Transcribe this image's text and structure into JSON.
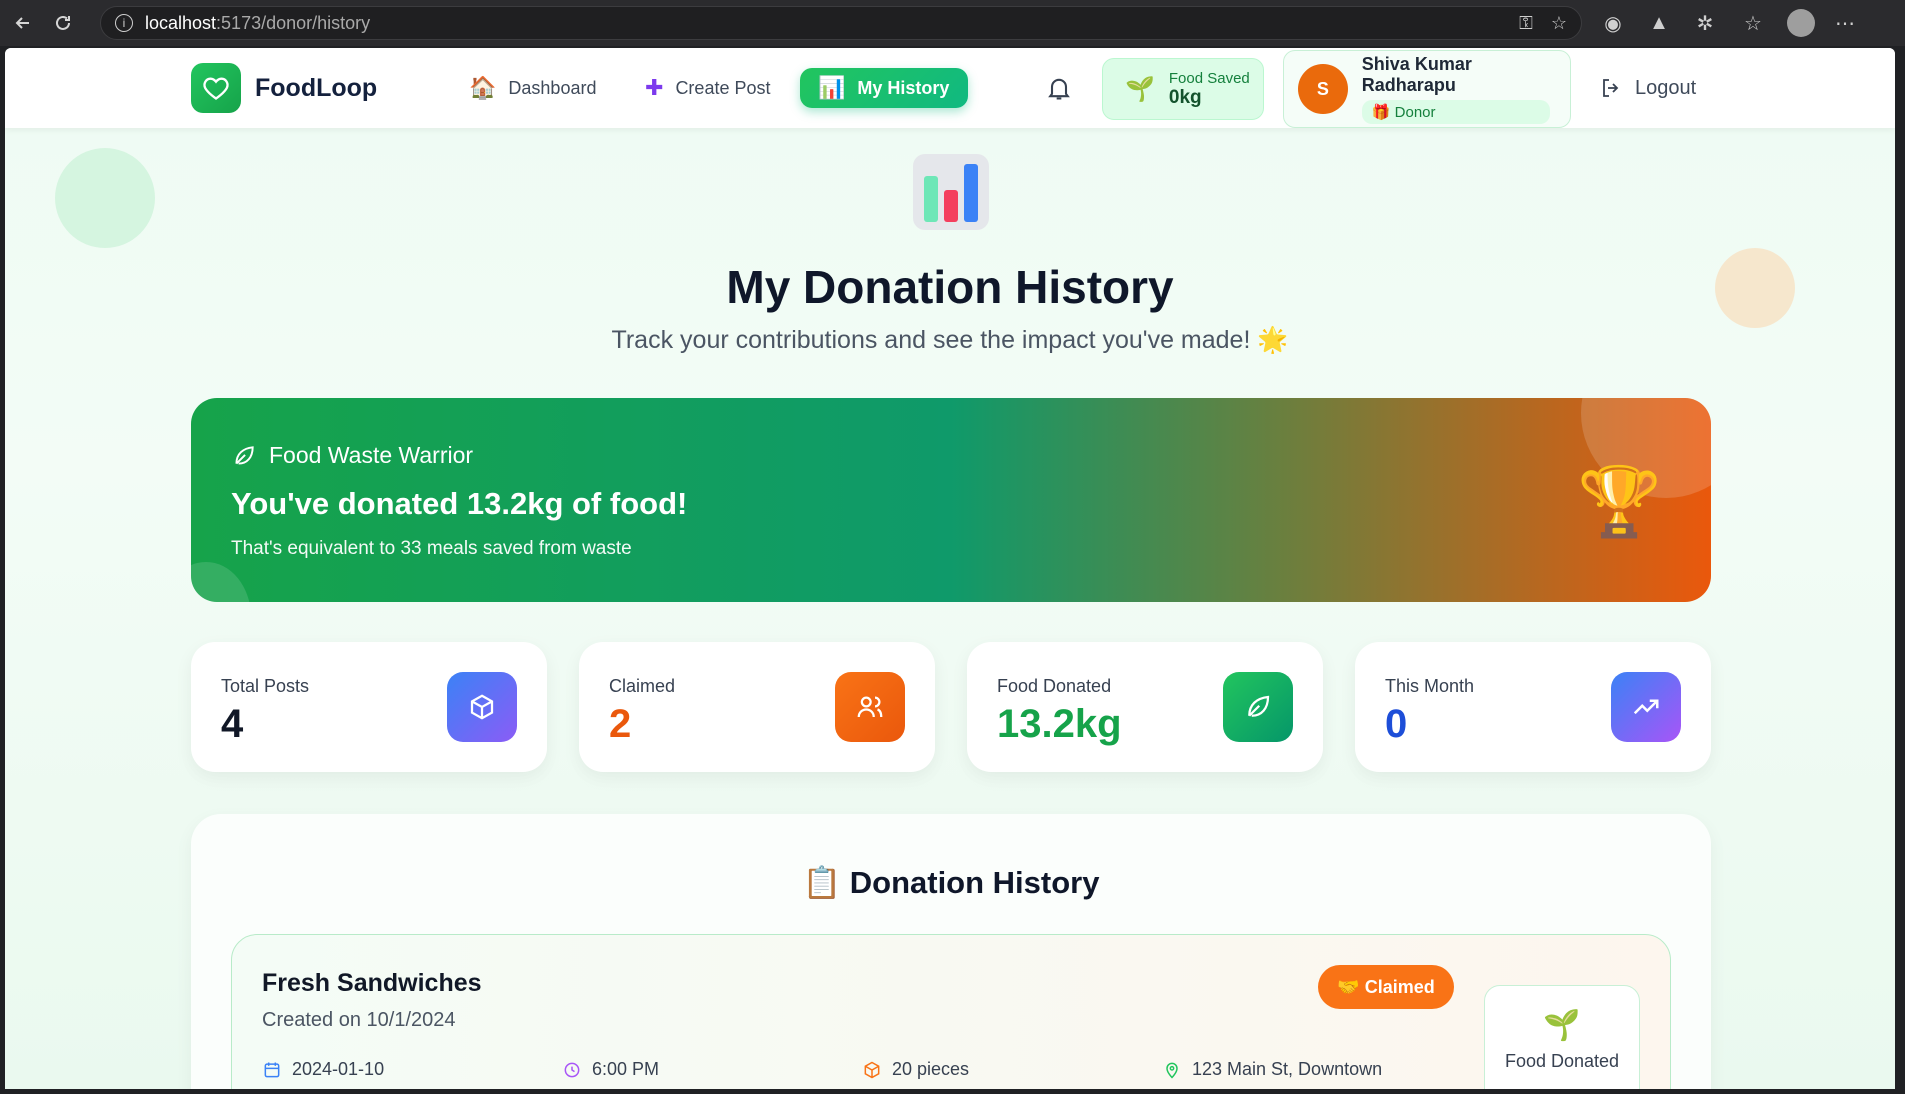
{
  "browser": {
    "url_host": "localhost",
    "url_path": ":5173/donor/history"
  },
  "nav": {
    "brand": "FoodLoop",
    "links": [
      {
        "label": "Dashboard",
        "emoji": "🏠"
      },
      {
        "label": "Create Post",
        "emoji": "➕"
      },
      {
        "label": "My History",
        "emoji": "📊"
      }
    ],
    "food_saved_label": "Food Saved",
    "food_saved_value": "0kg",
    "user": {
      "initial": "S",
      "name": "Shiva Kumar Radharapu",
      "role": "Donor"
    },
    "logout": "Logout"
  },
  "header": {
    "title": "My Donation History",
    "subtitle": "Track your contributions and see the impact you've made! 🌟"
  },
  "banner": {
    "tag": "Food Waste Warrior",
    "headline": "You've donated 13.2kg of food!",
    "note": "That's equivalent to 33 meals saved from waste",
    "trophy": "🏆"
  },
  "stats": [
    {
      "label": "Total Posts",
      "value": "4",
      "color": "#111827"
    },
    {
      "label": "Claimed",
      "value": "2",
      "color": "#ea580c"
    },
    {
      "label": "Food Donated",
      "value": "13.2kg",
      "color": "#16a34a"
    },
    {
      "label": "This Month",
      "value": "0",
      "color": "#1d4ed8"
    }
  ],
  "history": {
    "title": "📋 Donation History",
    "items": [
      {
        "title": "Fresh Sandwiches",
        "created": "Created on 10/1/2024",
        "status": "🤝 Claimed",
        "date": "2024-01-10",
        "time": "6:00 PM",
        "quantity": "20 pieces",
        "location": "123 Main St, Downtown",
        "impact_label": "Food Donated"
      }
    ]
  },
  "colors": {
    "accent": "#22c55e",
    "claimed": "#f97316"
  }
}
